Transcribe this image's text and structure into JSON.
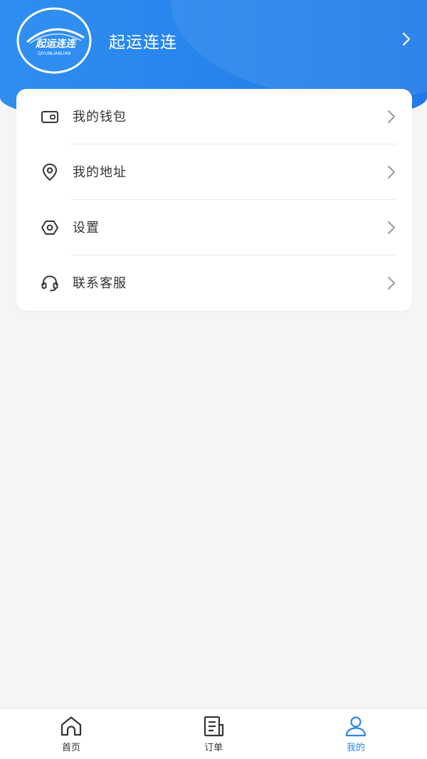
{
  "profile": {
    "app_name": "起运连连",
    "logo_text": "起运连连",
    "logo_subtext": "QIYUNLIANLIAN"
  },
  "menu": {
    "items": [
      {
        "label": "我的钱包",
        "icon": "wallet-icon"
      },
      {
        "label": "我的地址",
        "icon": "location-pin-icon"
      },
      {
        "label": "设置",
        "icon": "settings-icon"
      },
      {
        "label": "联系客服",
        "icon": "headset-icon"
      }
    ]
  },
  "tabbar": {
    "tabs": [
      {
        "label": "首页",
        "icon": "home-icon",
        "active": false
      },
      {
        "label": "订单",
        "icon": "orders-icon",
        "active": false
      },
      {
        "label": "我的",
        "icon": "profile-icon",
        "active": true
      }
    ]
  },
  "colors": {
    "brand_blue": "#2f8ef0",
    "active_tab": "#2a86e8",
    "text_primary": "#333333",
    "background": "#f5f5f7"
  }
}
